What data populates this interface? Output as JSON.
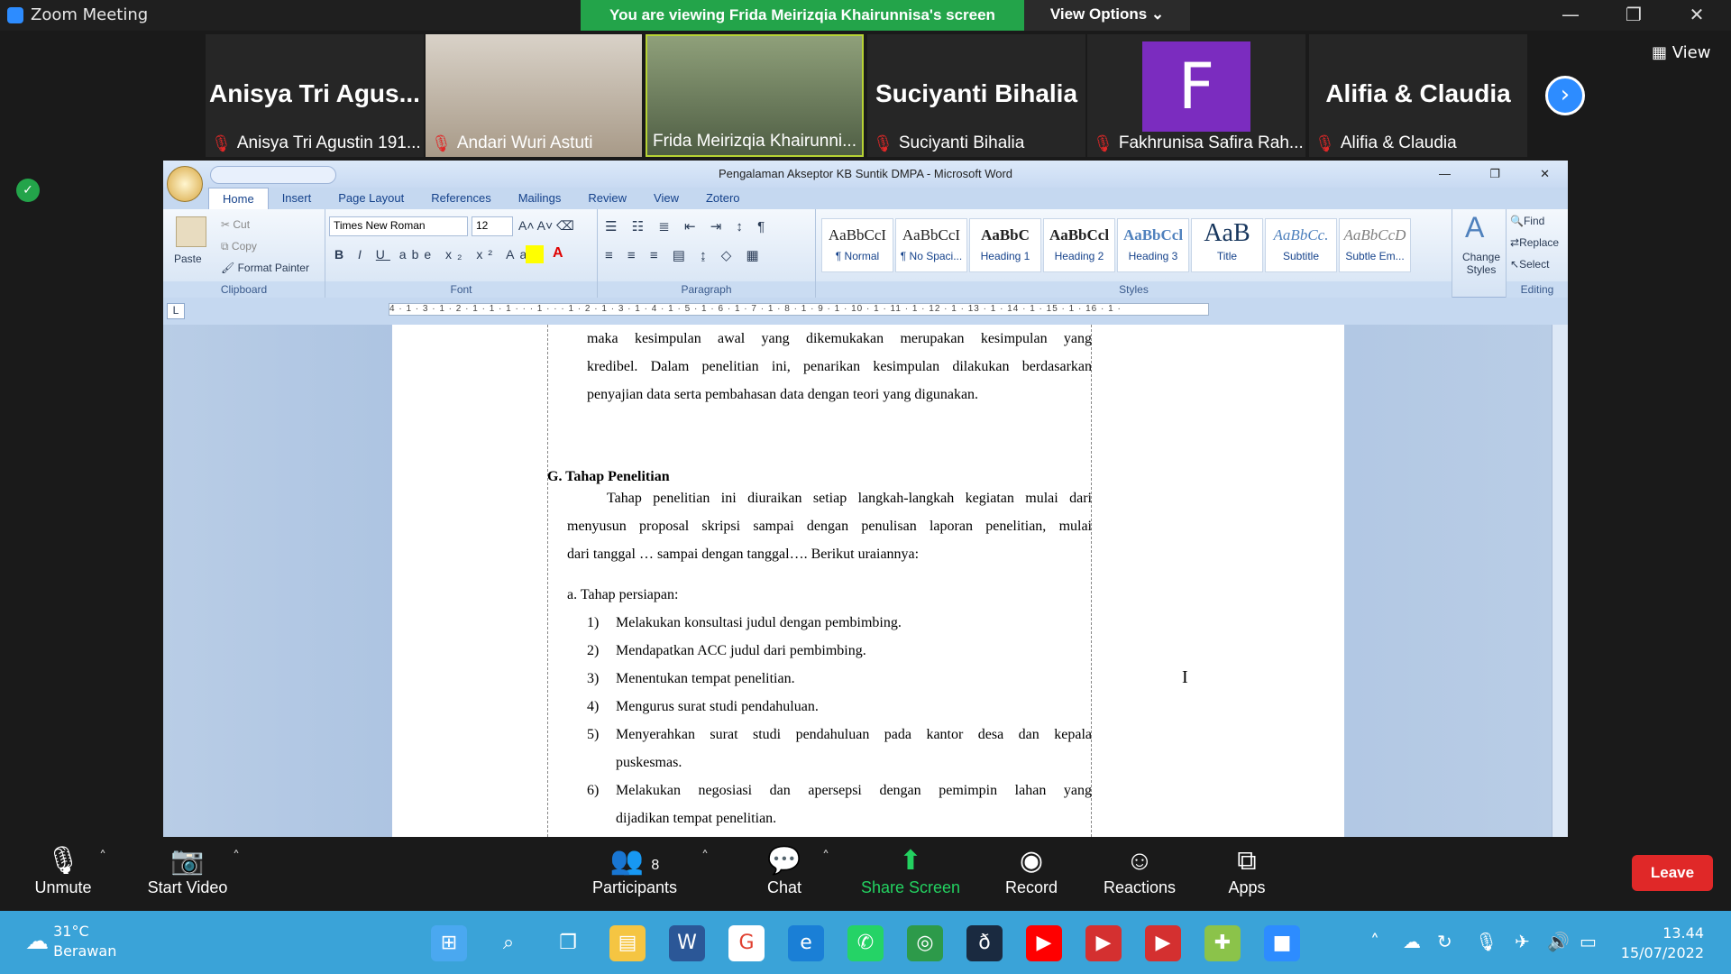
{
  "zoom": {
    "app_title": "Zoom Meeting",
    "banner": "You are viewing Frida Meirizqia Khairunnisa's screen",
    "view_options": "View Options ⌄",
    "view_label": "View",
    "participants_tiles": [
      {
        "big": "Anisya  Tri  Agus...",
        "label": "Anisya Tri Agustin 191..."
      },
      {
        "big": "",
        "label": "Andari Wuri Astuti"
      },
      {
        "big": "",
        "label": "Frida Meirizqia Khairunni..."
      },
      {
        "big": "Suciyanti Bihalia",
        "label": "Suciyanti Bihalia"
      },
      {
        "big": "F",
        "label": "Fakhrunisa Safira Rah..."
      },
      {
        "big": "Alifia & Claudia",
        "label": "Alifia & Claudia"
      }
    ],
    "controls": {
      "unmute": "Unmute",
      "start_video": "Start Video",
      "participants": "Participants",
      "participants_count": "8",
      "chat": "Chat",
      "share_screen": "Share Screen",
      "record": "Record",
      "reactions": "Reactions",
      "apps": "Apps",
      "leave": "Leave"
    }
  },
  "word": {
    "title": "Pengalaman Akseptor KB Suntik DMPA - Microsoft Word",
    "tabs": [
      "Home",
      "Insert",
      "Page Layout",
      "References",
      "Mailings",
      "Review",
      "View",
      "Zotero"
    ],
    "clipboard": {
      "paste": "Paste",
      "cut": "Cut",
      "copy": "Copy",
      "format_painter": "Format Painter",
      "label": "Clipboard"
    },
    "font": {
      "name": "Times New Roman",
      "size": "12",
      "label": "Font"
    },
    "paragraph_label": "Paragraph",
    "styles": [
      {
        "preview": "AaBbCcI",
        "name": "¶ Normal"
      },
      {
        "preview": "AaBbCcI",
        "name": "¶ No Spaci..."
      },
      {
        "preview": "AaBbC",
        "name": "Heading 1"
      },
      {
        "preview": "AaBbCcl",
        "name": "Heading 2"
      },
      {
        "preview": "AaBbCcl",
        "name": "Heading 3"
      },
      {
        "preview": "AaB",
        "name": "Title"
      },
      {
        "preview": "AaBbCc.",
        "name": "Subtitle"
      },
      {
        "preview": "AaBbCcD",
        "name": "Subtle Em..."
      }
    ],
    "styles_label": "Styles",
    "change_styles": "Change Styles",
    "editing": {
      "find": "Find",
      "replace": "Replace",
      "select": "Select",
      "label": "Editing"
    },
    "ruler": "4 · 1 · 3 · 1 · 2 · 1 · 1 · 1 · · · 1 · · · 1 · 2 · 1 · 3 · 1 · 4 · 1 · 5 · 1 · 6 · 1 · 7 · 1 · 8 · 1 · 9 · 1 · 10 · 1 · 11 · 1 · 12 · 1 · 13 · 1 · 14 · 1 · 15 · 1 · 16 · 1 ·",
    "doc": {
      "p1_l1": "maka  kesimpulan  awal  yang  dikemukakan  merupakan  kesimpulan  yang",
      "p1_l2": "kredibel.  Dalam penelitian ini, penarikan kesimpulan dilakukan berdasarkan",
      "p1_l3": "penyajian data serta pembahasan data dengan teori yang digunakan.",
      "heading": "G. Tahap Penelitian",
      "p2_l1": "Tahap penelitian ini diuraikan setiap langkah-langkah kegiatan mulai dari",
      "p2_l2": "menyusun proposal skripsi sampai dengan penulisan laporan penelitian, mulai",
      "p2_l3": "dari tanggal … sampai dengan tanggal…. Berikut uraiannya:",
      "sub_a": "a.  Tahap persiapan:",
      "items": [
        {
          "n": "1)",
          "t": "Melakukan konsultasi judul dengan pembimbing."
        },
        {
          "n": "2)",
          "t": "Mendapatkan ACC judul dari pembimbing."
        },
        {
          "n": "3)",
          "t": "Menentukan tempat penelitian."
        },
        {
          "n": "4)",
          "t": "Mengurus surat studi pendahuluan."
        },
        {
          "n": "5)",
          "t": "Menyerahkan  surat  studi  pendahuluan  pada  kantor  desa  dan  kepala"
        },
        {
          "n": "",
          "t": "puskesmas."
        },
        {
          "n": "6)",
          "t": "Melakukan  negosiasi  dan  apersepsi  dengan  pemimpin  lahan  yang"
        },
        {
          "n": "",
          "t": "dijadikan tempat penelitian."
        }
      ]
    }
  },
  "taskbar": {
    "temp": "31°C",
    "weather": "Berawan",
    "time": "13.44",
    "date": "15/07/2022"
  }
}
